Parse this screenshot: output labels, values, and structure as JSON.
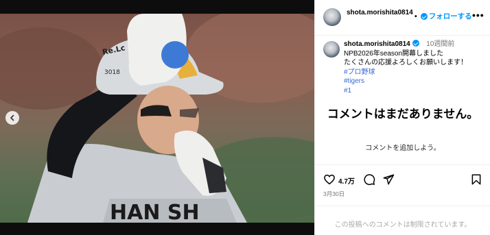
{
  "post": {
    "username": "shota.morishita0814",
    "follow_label": "フォローする",
    "dot": "•",
    "more_label": "•••"
  },
  "caption": {
    "username": "shota.morishita0814",
    "time": "10週間前",
    "line1": "NPB2026年season開幕しました",
    "line2": "たくさんの応援よろしくお願いします！",
    "hashtags": [
      "#プロ野球",
      "#tigers",
      "#1"
    ]
  },
  "comments": {
    "empty_title": "コメントはまだありません。",
    "add_prompt": "コメントを追加しよう。"
  },
  "actions": {
    "like_count": "4.7万",
    "date": "3月30日"
  },
  "footer": {
    "restricted_text": "この投稿へのコメントは制限されています。"
  },
  "photo": {
    "helmet_text": "Re. Lć 3018",
    "uniform_text": "HAN  SH"
  },
  "colors": {
    "accent": "#0095f6",
    "hashtag": "#3769d6",
    "muted": "#737373"
  },
  "icons": [
    "chevron-left-icon",
    "verified-badge-icon",
    "more-icon",
    "heart-icon",
    "comment-icon",
    "share-icon",
    "bookmark-icon"
  ]
}
